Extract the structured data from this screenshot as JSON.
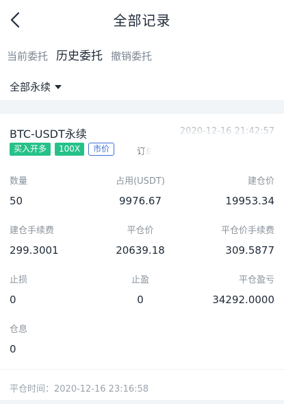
{
  "header": {
    "title": "全部记录",
    "back_icon": "chevron-left-icon"
  },
  "tabs": [
    {
      "label": "当前委托",
      "active": false
    },
    {
      "label": "历史委托",
      "active": true
    },
    {
      "label": "撤销委托",
      "active": false
    }
  ],
  "filter": {
    "label": "全部永续",
    "icon": "caret-down-icon"
  },
  "record": {
    "pair": "BTC-USDT永续",
    "timestamp": "2020-12-16 21:42:57",
    "tags": {
      "side": "买入开多",
      "leverage": "100X",
      "type": "市价"
    },
    "order_label": "订单",
    "fields": {
      "quantity_label": "数量",
      "quantity": "50",
      "margin_label": "占用(USDT)",
      "margin": "9976.67",
      "open_price_label": "建仓价",
      "open_price": "19953.34",
      "open_fee_label": "建仓手续费",
      "open_fee": "299.3001",
      "close_price_label": "平仓价",
      "close_price": "20639.18",
      "close_fee_label": "平仓价手续费",
      "close_fee": "309.5877",
      "stop_loss_label": "止损",
      "stop_loss": "0",
      "take_profit_label": "止盈",
      "take_profit": "0",
      "pnl_label": "平仓盈亏",
      "pnl": "34292.0000",
      "interest_label": "仓息",
      "interest": "0"
    },
    "close_time": "平仓时间：2020-12-16 23:16:58"
  },
  "colors": {
    "green_tag": "#26c189",
    "blue_tag": "#3f6fd8",
    "band": "#f1f5f7"
  }
}
